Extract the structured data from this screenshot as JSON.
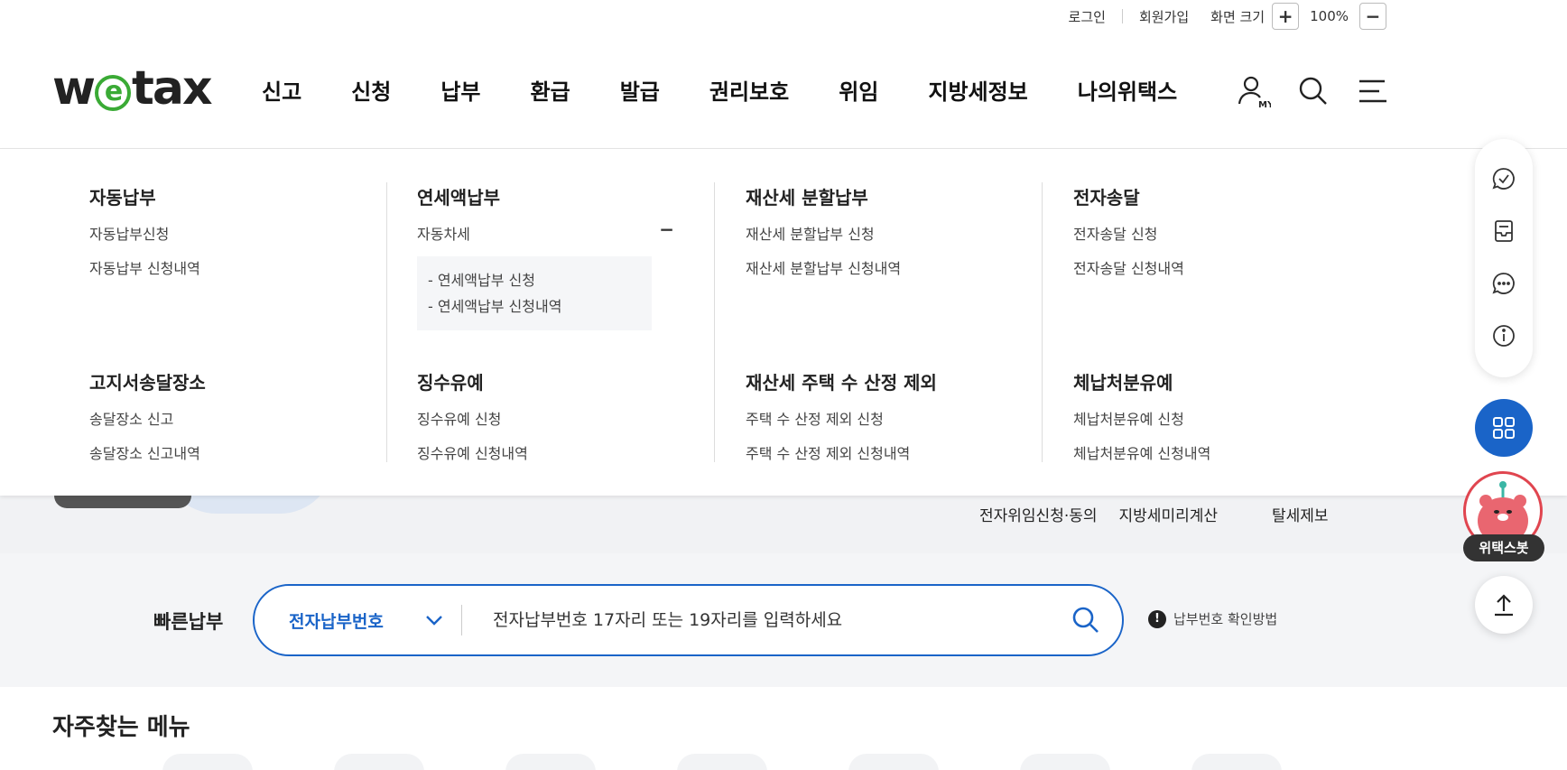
{
  "util": {
    "login": "로그인",
    "signup": "회원가입",
    "zoom_label": "화면 크기",
    "zoom_in": "+",
    "zoom_value": "100%",
    "zoom_out": "−"
  },
  "logo": {
    "pre": "w",
    "e": "e",
    "post": "tax"
  },
  "gnb": [
    "신고",
    "신청",
    "납부",
    "환급",
    "발급",
    "권리보호",
    "위임",
    "지방세정보",
    "나의위택스"
  ],
  "header_icons": [
    "my-page-icon",
    "search-icon",
    "hamburger-menu-icon"
  ],
  "mega": {
    "col1": {
      "group1": {
        "title": "자동납부",
        "items": [
          "자동납부신청",
          "자동납부 신청내역"
        ]
      },
      "group2": {
        "title": "고지서송달장소",
        "items": [
          "송달장소 신고",
          "송달장소 신고내역"
        ]
      }
    },
    "col2": {
      "group1": {
        "title": "연세액납부",
        "toggle": "자동차세",
        "toggle_icon": "−",
        "sub": [
          "-  연세액납부 신청",
          "-  연세액납부 신청내역"
        ]
      },
      "group2": {
        "title": "징수유예",
        "items": [
          "징수유예 신청",
          "징수유예 신청내역"
        ]
      }
    },
    "col3": {
      "group1": {
        "title": "재산세 분할납부",
        "items": [
          "재산세 분할납부 신청",
          "재산세 분할납부 신청내역"
        ]
      },
      "group2": {
        "title": "재산세 주택 수 산정 제외",
        "items": [
          "주택 수 산정 제외 신청",
          "주택 수 산정 제외 신청내역"
        ]
      }
    },
    "col4": {
      "group1": {
        "title": "전자송달",
        "items": [
          "전자송달 신청",
          "전자송달 신청내역"
        ]
      },
      "group2": {
        "title": "체납처분유예",
        "items": [
          "체납처분유예 신청",
          "체납처분유예 신청내역"
        ]
      }
    }
  },
  "hero_links": [
    "전자위임신청·동의",
    "지방세미리계산",
    "탈세제보"
  ],
  "quick": {
    "label": "빠른납부",
    "select_value": "전자납부번호",
    "placeholder": "전자납부번호 17자리 또는 19자리를 입력하세요",
    "help": "납부번호 확인방법"
  },
  "freq": {
    "title": "자주찾는 메뉴"
  },
  "rail": {
    "icons": [
      "check-chat-icon",
      "inbox-icon",
      "chat-icon",
      "info-icon"
    ],
    "all_menu_icon": "grid-icon",
    "bot_label": "위택스봇",
    "top_icon": "arrow-up-icon"
  },
  "colors": {
    "brand_blue": "#1a64c8",
    "logo_green": "#3aaa35",
    "bot_red": "#e0454f"
  }
}
